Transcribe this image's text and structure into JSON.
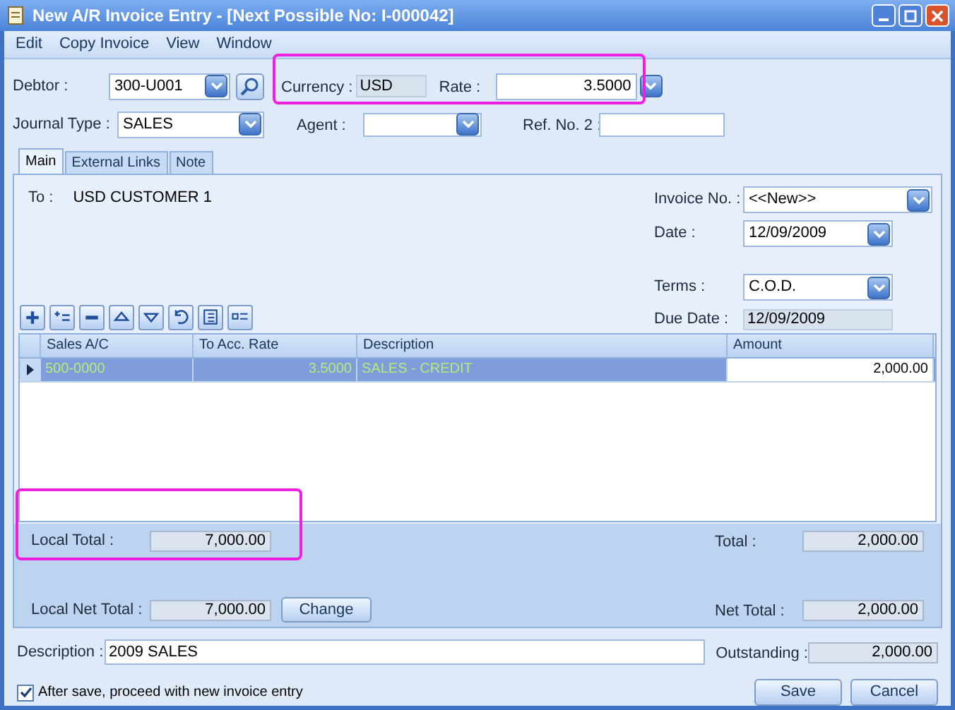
{
  "window": {
    "title": "New A/R Invoice Entry - [Next Possible No: I-000042]"
  },
  "menu": [
    {
      "label": "Edit"
    },
    {
      "label": "Copy Invoice"
    },
    {
      "label": "View"
    },
    {
      "label": "Window"
    }
  ],
  "header": {
    "debtor": {
      "label": "Debtor :",
      "value": "300-U001"
    },
    "journal_type": {
      "label": "Journal Type :",
      "value": "SALES"
    },
    "currency": {
      "label": "Currency :",
      "value": "USD"
    },
    "rate": {
      "label": "Rate :",
      "value": "3.5000"
    },
    "agent": {
      "label": "Agent :"
    },
    "ref_no_2": {
      "label": "Ref. No. 2 :"
    }
  },
  "tabs": [
    {
      "label": "Main",
      "selected": true
    },
    {
      "label": "External Links",
      "selected": false
    },
    {
      "label": "Note",
      "selected": false
    }
  ],
  "to": {
    "label": "To :",
    "value": "USD CUSTOMER 1"
  },
  "invoice_fields": [
    {
      "label": "Invoice No. :",
      "value": "<<New>>",
      "kind": "dropdown"
    },
    {
      "label": "Date :",
      "value": "12/09/2009",
      "kind": "dropdown"
    },
    {
      "label": "Terms :",
      "value": "C.O.D.",
      "kind": "dropdown"
    },
    {
      "label": "Due Date :",
      "value": "12/09/2009",
      "kind": "readonly"
    }
  ],
  "table": {
    "columns": [
      "Sales A/C",
      "To Acc. Rate",
      "Description",
      "Amount"
    ],
    "rows": [
      {
        "cells": [
          "500-0000",
          "3.5000",
          "SALES - CREDIT",
          "2,000.00"
        ],
        "selected": true
      }
    ]
  },
  "totals": {
    "local_total": {
      "label": "Local Total :",
      "value": "7,000.00"
    },
    "total": {
      "label": "Total :",
      "value": "2,000.00"
    },
    "local_net_total": {
      "label": "Local Net Total :",
      "value": "7,000.00"
    },
    "net_total": {
      "label": "Net Total :",
      "value": "2,000.00"
    },
    "change_button": "Change"
  },
  "description": {
    "label": "Description :",
    "value": "2009 SALES"
  },
  "outstanding": {
    "label": "Outstanding :",
    "value": "2,000.00"
  },
  "after_save": {
    "label": "After save, proceed with new invoice entry",
    "checked": true
  },
  "buttons": [
    "Save",
    "Cancel"
  ]
}
